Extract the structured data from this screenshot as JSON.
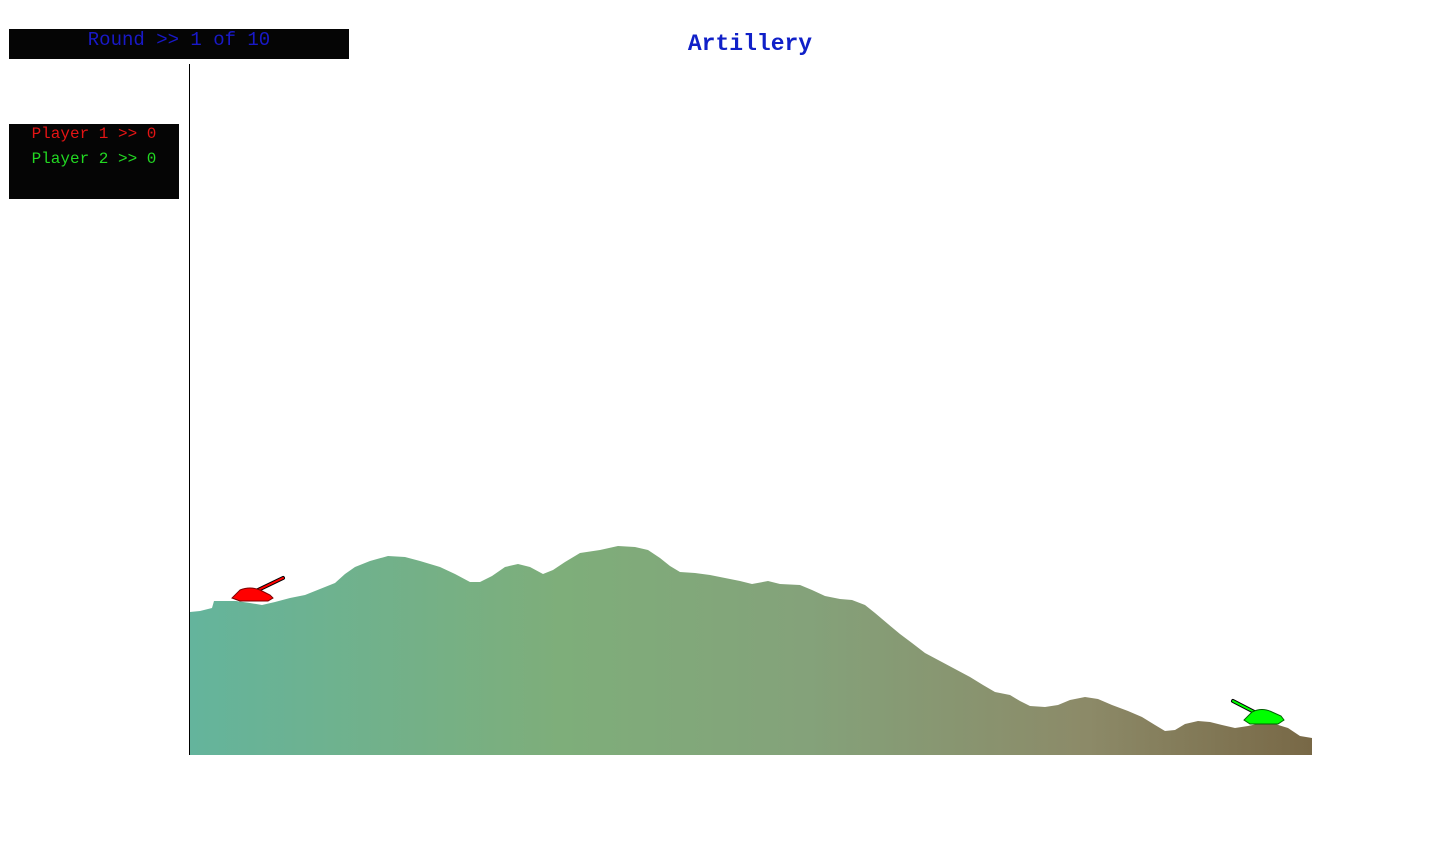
{
  "game": {
    "title": "Artillery",
    "round_text": "Round >> 1 of 10"
  },
  "scoreboard": {
    "player1_text": "Player 1 >> 0",
    "player2_text": "Player 2 >> 0"
  },
  "players": [
    {
      "name": "Player 1",
      "color": "#ff0000",
      "score": 0
    },
    {
      "name": "Player 2",
      "color": "#00ff00",
      "score": 0
    }
  ],
  "colors": {
    "panel_background": "#050505",
    "round_text": "#1919c8",
    "title_text": "#1020c8",
    "terrain_left": "#64b49c",
    "terrain_mid": "#7eac7a",
    "terrain_right": "#786846"
  }
}
